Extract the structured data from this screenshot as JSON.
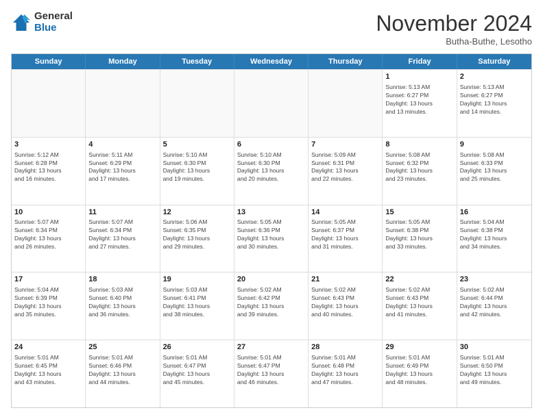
{
  "logo": {
    "general": "General",
    "blue": "Blue"
  },
  "title": "November 2024",
  "location": "Butha-Buthe, Lesotho",
  "weekdays": [
    "Sunday",
    "Monday",
    "Tuesday",
    "Wednesday",
    "Thursday",
    "Friday",
    "Saturday"
  ],
  "rows": [
    [
      {
        "day": "",
        "info": ""
      },
      {
        "day": "",
        "info": ""
      },
      {
        "day": "",
        "info": ""
      },
      {
        "day": "",
        "info": ""
      },
      {
        "day": "",
        "info": ""
      },
      {
        "day": "1",
        "info": "Sunrise: 5:13 AM\nSunset: 6:27 PM\nDaylight: 13 hours\nand 13 minutes."
      },
      {
        "day": "2",
        "info": "Sunrise: 5:13 AM\nSunset: 6:27 PM\nDaylight: 13 hours\nand 14 minutes."
      }
    ],
    [
      {
        "day": "3",
        "info": "Sunrise: 5:12 AM\nSunset: 6:28 PM\nDaylight: 13 hours\nand 16 minutes."
      },
      {
        "day": "4",
        "info": "Sunrise: 5:11 AM\nSunset: 6:29 PM\nDaylight: 13 hours\nand 17 minutes."
      },
      {
        "day": "5",
        "info": "Sunrise: 5:10 AM\nSunset: 6:30 PM\nDaylight: 13 hours\nand 19 minutes."
      },
      {
        "day": "6",
        "info": "Sunrise: 5:10 AM\nSunset: 6:30 PM\nDaylight: 13 hours\nand 20 minutes."
      },
      {
        "day": "7",
        "info": "Sunrise: 5:09 AM\nSunset: 6:31 PM\nDaylight: 13 hours\nand 22 minutes."
      },
      {
        "day": "8",
        "info": "Sunrise: 5:08 AM\nSunset: 6:32 PM\nDaylight: 13 hours\nand 23 minutes."
      },
      {
        "day": "9",
        "info": "Sunrise: 5:08 AM\nSunset: 6:33 PM\nDaylight: 13 hours\nand 25 minutes."
      }
    ],
    [
      {
        "day": "10",
        "info": "Sunrise: 5:07 AM\nSunset: 6:34 PM\nDaylight: 13 hours\nand 26 minutes."
      },
      {
        "day": "11",
        "info": "Sunrise: 5:07 AM\nSunset: 6:34 PM\nDaylight: 13 hours\nand 27 minutes."
      },
      {
        "day": "12",
        "info": "Sunrise: 5:06 AM\nSunset: 6:35 PM\nDaylight: 13 hours\nand 29 minutes."
      },
      {
        "day": "13",
        "info": "Sunrise: 5:05 AM\nSunset: 6:36 PM\nDaylight: 13 hours\nand 30 minutes."
      },
      {
        "day": "14",
        "info": "Sunrise: 5:05 AM\nSunset: 6:37 PM\nDaylight: 13 hours\nand 31 minutes."
      },
      {
        "day": "15",
        "info": "Sunrise: 5:05 AM\nSunset: 6:38 PM\nDaylight: 13 hours\nand 33 minutes."
      },
      {
        "day": "16",
        "info": "Sunrise: 5:04 AM\nSunset: 6:38 PM\nDaylight: 13 hours\nand 34 minutes."
      }
    ],
    [
      {
        "day": "17",
        "info": "Sunrise: 5:04 AM\nSunset: 6:39 PM\nDaylight: 13 hours\nand 35 minutes."
      },
      {
        "day": "18",
        "info": "Sunrise: 5:03 AM\nSunset: 6:40 PM\nDaylight: 13 hours\nand 36 minutes."
      },
      {
        "day": "19",
        "info": "Sunrise: 5:03 AM\nSunset: 6:41 PM\nDaylight: 13 hours\nand 38 minutes."
      },
      {
        "day": "20",
        "info": "Sunrise: 5:02 AM\nSunset: 6:42 PM\nDaylight: 13 hours\nand 39 minutes."
      },
      {
        "day": "21",
        "info": "Sunrise: 5:02 AM\nSunset: 6:43 PM\nDaylight: 13 hours\nand 40 minutes."
      },
      {
        "day": "22",
        "info": "Sunrise: 5:02 AM\nSunset: 6:43 PM\nDaylight: 13 hours\nand 41 minutes."
      },
      {
        "day": "23",
        "info": "Sunrise: 5:02 AM\nSunset: 6:44 PM\nDaylight: 13 hours\nand 42 minutes."
      }
    ],
    [
      {
        "day": "24",
        "info": "Sunrise: 5:01 AM\nSunset: 6:45 PM\nDaylight: 13 hours\nand 43 minutes."
      },
      {
        "day": "25",
        "info": "Sunrise: 5:01 AM\nSunset: 6:46 PM\nDaylight: 13 hours\nand 44 minutes."
      },
      {
        "day": "26",
        "info": "Sunrise: 5:01 AM\nSunset: 6:47 PM\nDaylight: 13 hours\nand 45 minutes."
      },
      {
        "day": "27",
        "info": "Sunrise: 5:01 AM\nSunset: 6:47 PM\nDaylight: 13 hours\nand 46 minutes."
      },
      {
        "day": "28",
        "info": "Sunrise: 5:01 AM\nSunset: 6:48 PM\nDaylight: 13 hours\nand 47 minutes."
      },
      {
        "day": "29",
        "info": "Sunrise: 5:01 AM\nSunset: 6:49 PM\nDaylight: 13 hours\nand 48 minutes."
      },
      {
        "day": "30",
        "info": "Sunrise: 5:01 AM\nSunset: 6:50 PM\nDaylight: 13 hours\nand 49 minutes."
      }
    ]
  ]
}
